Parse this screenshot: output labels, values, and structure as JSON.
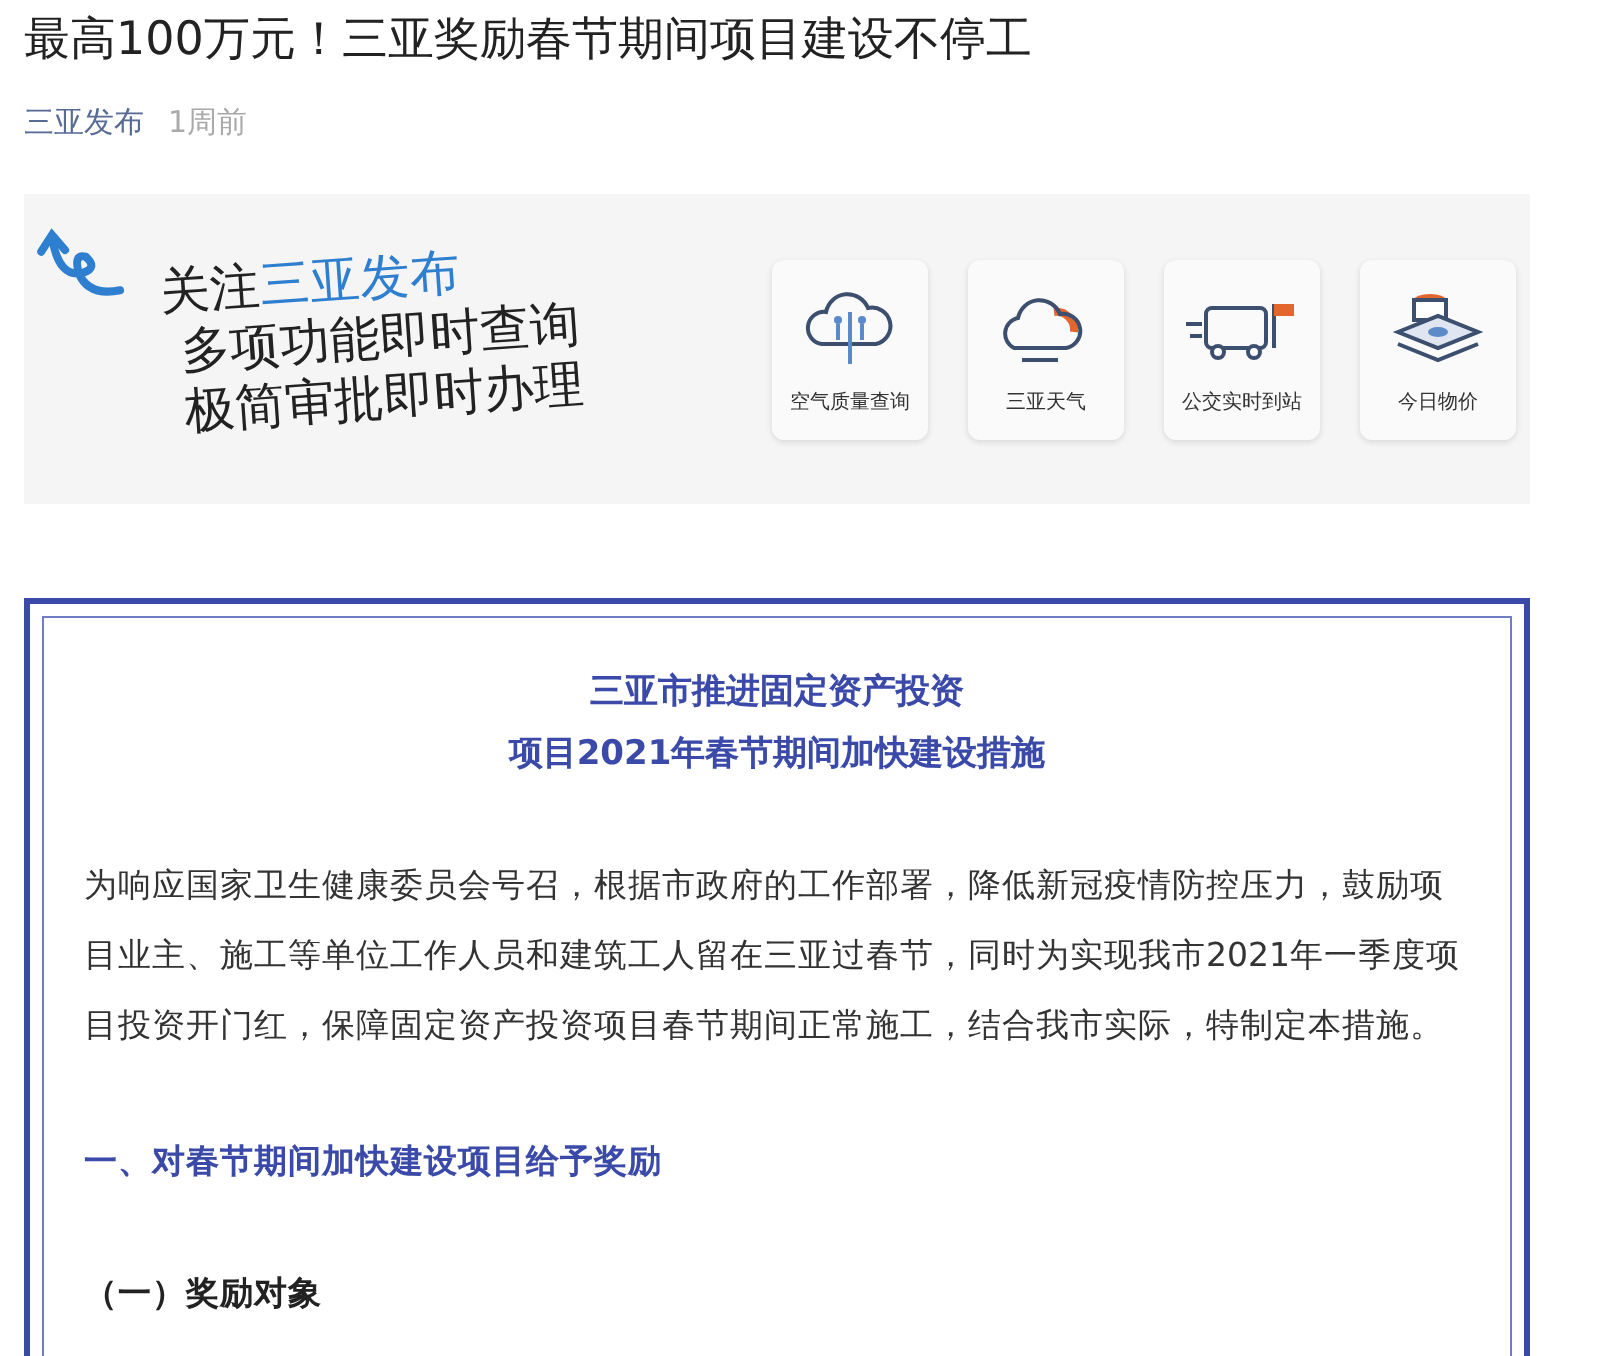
{
  "article": {
    "title": "最高100万元！三亚奖励春节期间项目建设不停工",
    "author": "三亚发布",
    "time": "1周前"
  },
  "banner": {
    "slogan_lead": "关注",
    "slogan_brand": "三亚发布",
    "slogan_lines": [
      "多项功能即时查询",
      "极简审批即时办理"
    ],
    "services": [
      {
        "kind": "air",
        "label": "空气质量查询"
      },
      {
        "kind": "weather",
        "label": "三亚天气"
      },
      {
        "kind": "bus",
        "label": "公交实时到站"
      },
      {
        "kind": "price",
        "label": "今日物价"
      }
    ]
  },
  "notice": {
    "title_lines": [
      "三亚市推进固定资产投资",
      "项目2021年春节期间加快建设措施"
    ],
    "paragraph": "为响应国家卫生健康委员会号召，根据市政府的工作部署，降低新冠疫情防控压力，鼓励项目业主、施工等单位工作人员和建筑工人留在三亚过春节，同时为实现我市2021年一季度项目投资开门红，保障固定资产投资项目春节期间正常施工，结合我市实际，特制定本措施。",
    "section_heading": "一、对春节期间加快建设项目给予奖励",
    "subsection_heading": "（一）奖励对象"
  }
}
